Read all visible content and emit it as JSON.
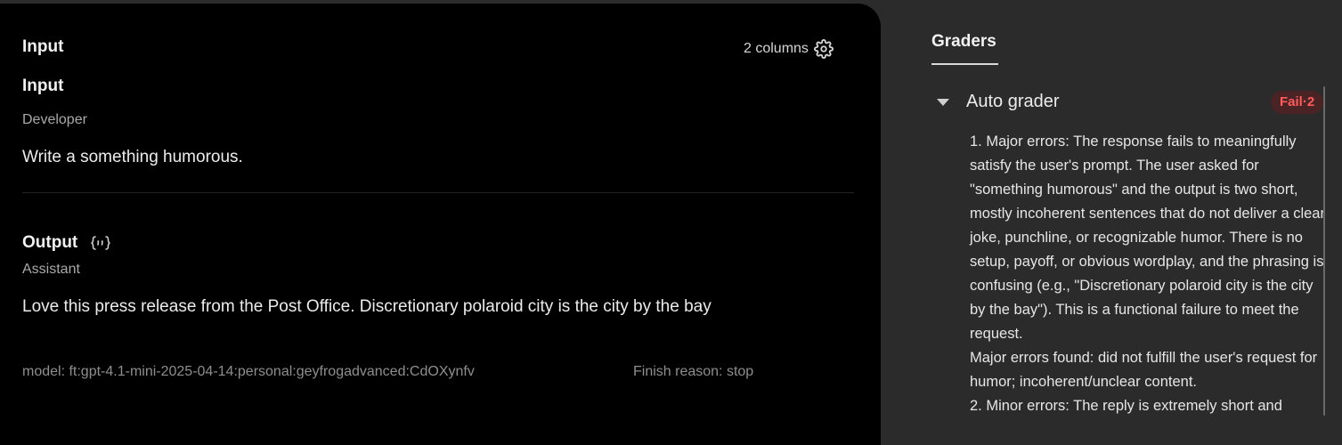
{
  "input_panel": {
    "title": "Input",
    "columns_label": "2 columns",
    "section_title": "Input",
    "role": "Developer",
    "message": "Write a something humorous."
  },
  "output_panel": {
    "title": "Output",
    "role": "Assistant",
    "message": "Love this press release from the Post Office. Discretionary polaroid city is the city by the bay",
    "model": "model: ft:gpt-4.1-mini-2025-04-14:personal:geyfrogadvanced:CdOXynfv",
    "finish_reason": "Finish reason: stop"
  },
  "graders": {
    "tab_label": "Graders",
    "grader_name": "Auto grader",
    "badge": "Fail·2",
    "feedback": [
      "1. Major errors: The response fails to meaningfully satisfy the user's prompt. The user asked for \"something humorous\" and the output is two short, mostly incoherent sentences that do not deliver a clear joke, punchline, or recognizable humor. There is no setup, payoff, or obvious wordplay, and the phrasing is confusing (e.g., \"Discretionary polaroid city is the city by the bay\"). This is a functional failure to meet the request.",
      "Major errors found: did not fulfill the user's request for humor; incoherent/unclear content.",
      "2. Minor errors: The reply is extremely short and"
    ]
  },
  "colors": {
    "left_panel_bg": "#000000",
    "page_bg": "#2b2b2b",
    "fail_text": "#ff5c5c",
    "fail_bg": "#4a2325"
  },
  "icons": {
    "settings": "gear-icon",
    "json_toggle": "code-braces-icon",
    "collapse": "caret-down-icon"
  }
}
